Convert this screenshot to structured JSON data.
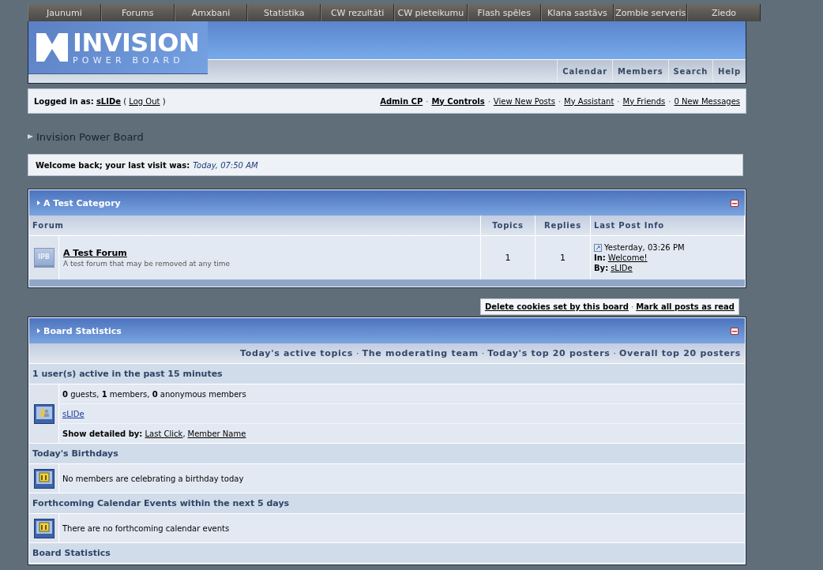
{
  "nav_menu": [
    {
      "label": "Jaunumi"
    },
    {
      "label": "Forums"
    },
    {
      "label": "Amxbani"
    },
    {
      "label": "Statistika"
    },
    {
      "label": "CW rezultāti"
    },
    {
      "label": "CW pieteikumu"
    },
    {
      "label": "Flash spēles"
    },
    {
      "label": "Klana sastāvs"
    },
    {
      "label": "Zombie serveris"
    },
    {
      "label": "Ziedo"
    }
  ],
  "logo": {
    "title": "INVISION",
    "subtitle": "POWER BOARD"
  },
  "header_links": [
    "Calendar",
    "Members",
    "Search",
    "Help"
  ],
  "user_bar": {
    "prefix": "Logged in as:",
    "username": "sLIDe",
    "open": "(",
    "logout": "Log Out",
    "close": ")",
    "separator": "·",
    "links": [
      {
        "label": "Admin CP",
        "bold": true
      },
      {
        "label": "My Controls",
        "bold": true
      },
      {
        "label": "View New Posts",
        "bold": false
      },
      {
        "label": "My Assistant",
        "bold": false
      },
      {
        "label": "My Friends",
        "bold": false
      },
      {
        "label": "0 New Messages",
        "bold": false
      }
    ]
  },
  "breadcrumb": "Invision Power Board",
  "welcome": {
    "text": "Welcome back; your last visit was:",
    "time": "Today, 07:50 AM"
  },
  "category": {
    "title": "A Test Category",
    "columns": [
      "Forum",
      "Topics",
      "Replies",
      "Last Post Info"
    ],
    "forums": [
      {
        "icon_label": "IPB",
        "name": "A Test Forum",
        "description": "A test forum that may be removed at any time",
        "topics": "1",
        "replies": "1",
        "last_post_time": "Yesterday, 03:26 PM",
        "in_label": "In:",
        "in_topic": "Welcome!",
        "by_label": "By:",
        "by_user": "sLIDe"
      }
    ]
  },
  "board_links": {
    "separator": "·",
    "links": [
      "Delete cookies set by this board",
      "Mark all posts as read"
    ]
  },
  "stats": {
    "title": "Board Statistics",
    "separator": "·",
    "links": [
      "Today's active topics",
      "The moderating team",
      "Today's top 20 posters",
      "Overall top 20 posters"
    ],
    "sections": [
      {
        "heading": "1 user(s) active in the past 15 minutes",
        "kind": "online",
        "lines": [
          {
            "kind": "rich",
            "text": "**0** guests, **1** members, **0** anonymous members"
          },
          {
            "kind": "link",
            "text": "sLIDe"
          },
          {
            "kind": "links",
            "label": "Show detailed by:",
            "separator": ",",
            "links": [
              "Last Click",
              "Member Name"
            ]
          }
        ]
      },
      {
        "heading": "Today's Birthdays",
        "kind": "calendar",
        "lines": [
          {
            "kind": "text",
            "text": "No members are celebrating a birthday today"
          }
        ]
      },
      {
        "heading": "Forthcoming Calendar Events within the next 5 days",
        "kind": "calendar",
        "lines": [
          {
            "kind": "text",
            "text": "There are no forthcoming calendar events"
          }
        ]
      },
      {
        "heading": "Board Statistics",
        "kind": "heading"
      }
    ]
  }
}
